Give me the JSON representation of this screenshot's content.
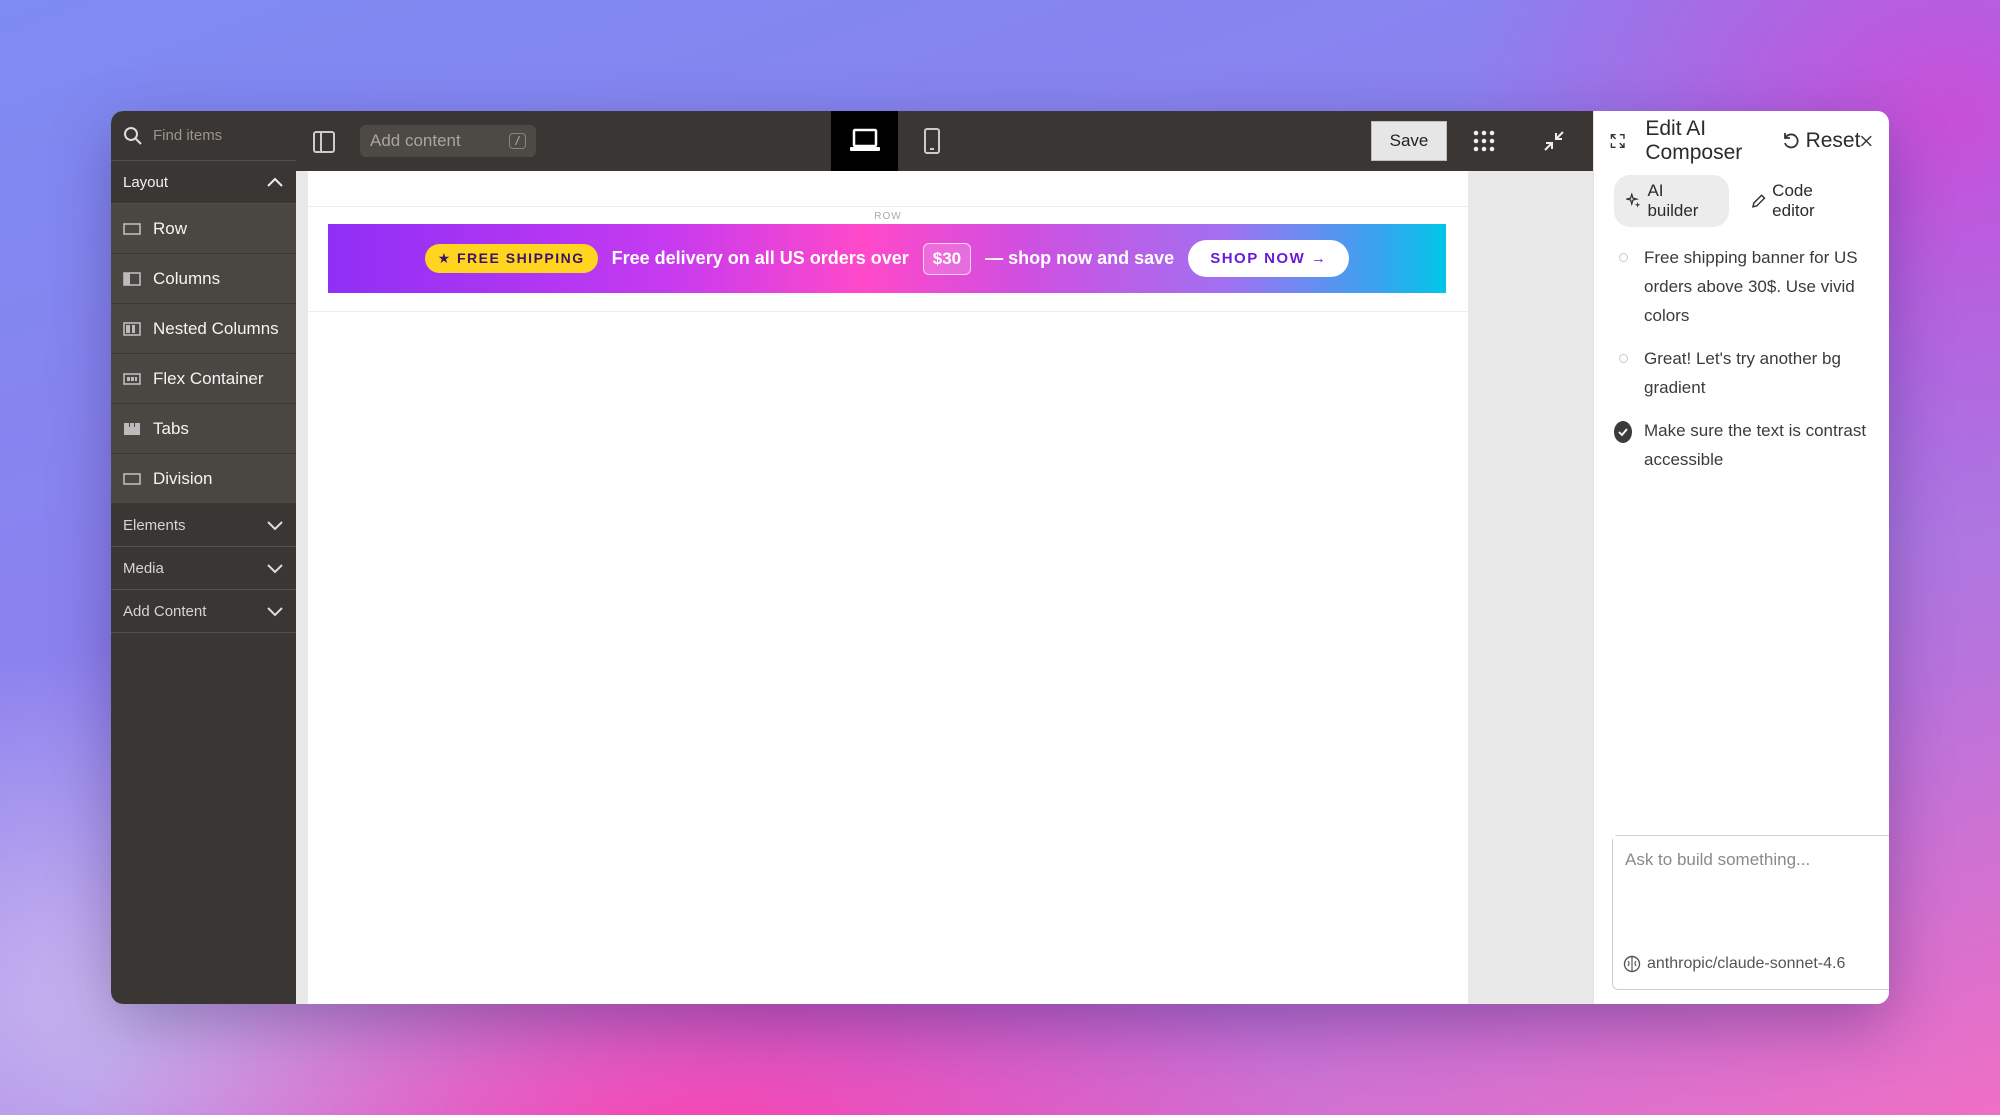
{
  "sidebar": {
    "search_placeholder": "Find items",
    "layout_section": "Layout",
    "layout_items": [
      {
        "label": "Row",
        "icon": "row-icon"
      },
      {
        "label": "Columns",
        "icon": "columns-icon"
      },
      {
        "label": "Nested Columns",
        "icon": "nested-columns-icon"
      },
      {
        "label": "Flex Container",
        "icon": "flex-container-icon"
      },
      {
        "label": "Tabs",
        "icon": "tabs-icon"
      },
      {
        "label": "Division",
        "icon": "division-icon"
      }
    ],
    "collapsed_sections": [
      "Elements",
      "Media",
      "Add Content"
    ]
  },
  "toolbar": {
    "add_content_placeholder": "Add content",
    "add_content_shortcut": "/",
    "save_label": "Save",
    "active_device": "desktop"
  },
  "canvas": {
    "row_label": "ROW",
    "banner": {
      "pill": "★ FREE SHIPPING",
      "text_before": "Free delivery on all US orders over",
      "price": "$30",
      "text_after": "— shop now and save",
      "cta": "SHOP NOW →"
    }
  },
  "ai_panel": {
    "title": "Edit AI Composer",
    "reset_label": "Reset",
    "tabs": [
      {
        "label": "AI builder",
        "active": true
      },
      {
        "label": "Code editor",
        "active": false
      }
    ],
    "history": [
      {
        "text": "Free shipping banner for US orders above 30$. Use vivid colors",
        "done": false
      },
      {
        "text": "Great! Let's try another bg gradient",
        "done": false
      },
      {
        "text": "Make sure the text is contrast accessible",
        "done": true
      }
    ],
    "composer_placeholder": "Ask to build something...",
    "model": "anthropic/claude-sonnet-4.6"
  },
  "colors": {
    "sidebar_bg": "#3a3633",
    "pill_yellow": "#ffd51f",
    "cta_text": "#6a1bd9"
  }
}
